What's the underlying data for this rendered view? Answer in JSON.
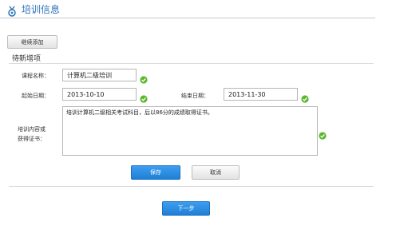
{
  "header": {
    "title": "培训信息",
    "icon": "medal-icon"
  },
  "toolbar": {
    "continue_label": "继续添加"
  },
  "section": {
    "title": "待新增项"
  },
  "form": {
    "course_label": "课程名称：",
    "course_value": "计算机二级培训",
    "start_label": "起始日期：",
    "start_value": "2013-10-10",
    "end_label": "结束日期：",
    "end_value": "2013-11-30",
    "content_label_line1": "培训内容或",
    "content_label_line2": "获得证书：",
    "content_value": "培训计算机二级相关考试科目，后以86分的成绩取得证书。"
  },
  "actions": {
    "save_label": "保存",
    "cancel_label": "取消",
    "next_label": "下一步"
  },
  "colors": {
    "accent": "#2a73b8",
    "button_blue": "#2a8ae2",
    "check_green": "#5cb82f"
  }
}
